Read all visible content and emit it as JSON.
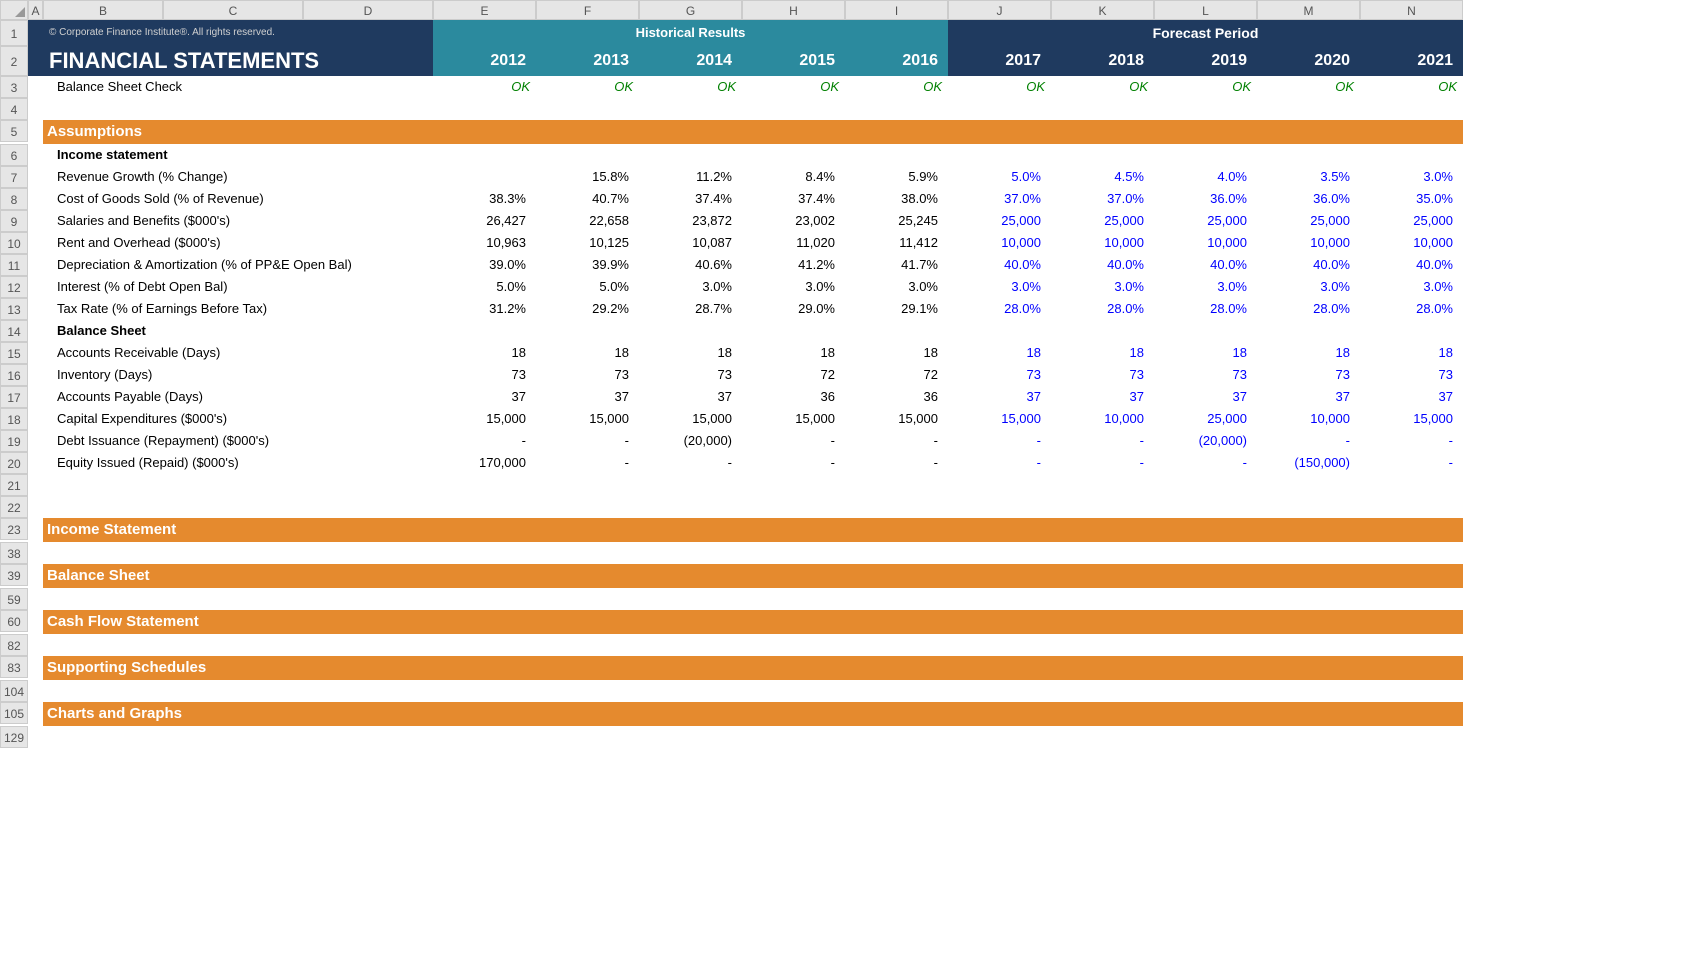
{
  "columns": [
    "A",
    "B",
    "C",
    "D",
    "E",
    "F",
    "G",
    "H",
    "I",
    "J",
    "K",
    "L",
    "M",
    "N"
  ],
  "row_numbers": [
    "1",
    "2",
    "3",
    "4",
    "5",
    "6",
    "7",
    "8",
    "9",
    "10",
    "11",
    "12",
    "13",
    "14",
    "15",
    "16",
    "17",
    "18",
    "19",
    "20",
    "21",
    "22",
    "23",
    "38",
    "39",
    "59",
    "60",
    "82",
    "83",
    "104",
    "105",
    "129"
  ],
  "copyright": "© Corporate Finance Institute®. All rights reserved.",
  "title": "FINANCIAL STATEMENTS",
  "hist_header": "Historical Results",
  "fcst_header": "Forecast Period",
  "years": {
    "e": "2012",
    "f": "2013",
    "g": "2014",
    "h": "2015",
    "i": "2016",
    "j": "2017",
    "k": "2018",
    "l": "2019",
    "m": "2020",
    "n": "2021"
  },
  "bs_check": {
    "label": "Balance Sheet Check",
    "e": "OK",
    "f": "OK",
    "g": "OK",
    "h": "OK",
    "i": "OK",
    "j": "OK",
    "k": "OK",
    "l": "OK",
    "m": "OK",
    "n": "OK"
  },
  "sections": {
    "assumptions": "Assumptions",
    "income_stmt_hdr": "Income statement",
    "balance_sheet_hdr": "Balance Sheet",
    "income_statement": "Income Statement",
    "balance_sheet": "Balance Sheet",
    "cash_flow": "Cash Flow Statement",
    "supporting": "Supporting Schedules",
    "charts": "Charts and Graphs"
  },
  "rows": {
    "rev_growth": {
      "label": "Revenue Growth (% Change)",
      "e": "",
      "f": "15.8%",
      "g": "11.2%",
      "h": "8.4%",
      "i": "5.9%",
      "j": "5.0%",
      "k": "4.5%",
      "l": "4.0%",
      "m": "3.5%",
      "n": "3.0%"
    },
    "cogs": {
      "label": "Cost of Goods Sold (% of Revenue)",
      "e": "38.3%",
      "f": "40.7%",
      "g": "37.4%",
      "h": "37.4%",
      "i": "38.0%",
      "j": "37.0%",
      "k": "37.0%",
      "l": "36.0%",
      "m": "36.0%",
      "n": "35.0%"
    },
    "salaries": {
      "label": "Salaries and Benefits ($000's)",
      "e": "26,427",
      "f": "22,658",
      "g": "23,872",
      "h": "23,002",
      "i": "25,245",
      "j": "25,000",
      "k": "25,000",
      "l": "25,000",
      "m": "25,000",
      "n": "25,000"
    },
    "rent": {
      "label": "Rent and Overhead ($000's)",
      "e": "10,963",
      "f": "10,125",
      "g": "10,087",
      "h": "11,020",
      "i": "11,412",
      "j": "10,000",
      "k": "10,000",
      "l": "10,000",
      "m": "10,000",
      "n": "10,000"
    },
    "da": {
      "label": "Depreciation & Amortization (% of PP&E Open Bal)",
      "e": "39.0%",
      "f": "39.9%",
      "g": "40.6%",
      "h": "41.2%",
      "i": "41.7%",
      "j": "40.0%",
      "k": "40.0%",
      "l": "40.0%",
      "m": "40.0%",
      "n": "40.0%"
    },
    "interest": {
      "label": "Interest (% of Debt Open Bal)",
      "e": "5.0%",
      "f": "5.0%",
      "g": "3.0%",
      "h": "3.0%",
      "i": "3.0%",
      "j": "3.0%",
      "k": "3.0%",
      "l": "3.0%",
      "m": "3.0%",
      "n": "3.0%"
    },
    "tax": {
      "label": "Tax Rate (% of Earnings Before Tax)",
      "e": "31.2%",
      "f": "29.2%",
      "g": "28.7%",
      "h": "29.0%",
      "i": "29.1%",
      "j": "28.0%",
      "k": "28.0%",
      "l": "28.0%",
      "m": "28.0%",
      "n": "28.0%"
    },
    "ar": {
      "label": "Accounts Receivable (Days)",
      "e": "18",
      "f": "18",
      "g": "18",
      "h": "18",
      "i": "18",
      "j": "18",
      "k": "18",
      "l": "18",
      "m": "18",
      "n": "18"
    },
    "inv": {
      "label": "Inventory (Days)",
      "e": "73",
      "f": "73",
      "g": "73",
      "h": "72",
      "i": "72",
      "j": "73",
      "k": "73",
      "l": "73",
      "m": "73",
      "n": "73"
    },
    "ap": {
      "label": "Accounts Payable (Days)",
      "e": "37",
      "f": "37",
      "g": "37",
      "h": "36",
      "i": "36",
      "j": "37",
      "k": "37",
      "l": "37",
      "m": "37",
      "n": "37"
    },
    "capex": {
      "label": "Capital Expenditures ($000's)",
      "e": "15,000",
      "f": "15,000",
      "g": "15,000",
      "h": "15,000",
      "i": "15,000",
      "j": "15,000",
      "k": "10,000",
      "l": "25,000",
      "m": "10,000",
      "n": "15,000"
    },
    "debt": {
      "label": "Debt Issuance (Repayment) ($000's)",
      "e": "-",
      "f": "-",
      "g": "(20,000)",
      "h": "-",
      "i": "-",
      "j": "-",
      "k": "-",
      "l": "(20,000)",
      "m": "-",
      "n": "-"
    },
    "equity": {
      "label": "Equity Issued (Repaid) ($000's)",
      "e": "170,000",
      "f": "-",
      "g": "-",
      "h": "-",
      "i": "-",
      "j": "-",
      "k": "-",
      "l": "-",
      "m": "(150,000)",
      "n": "-"
    }
  }
}
